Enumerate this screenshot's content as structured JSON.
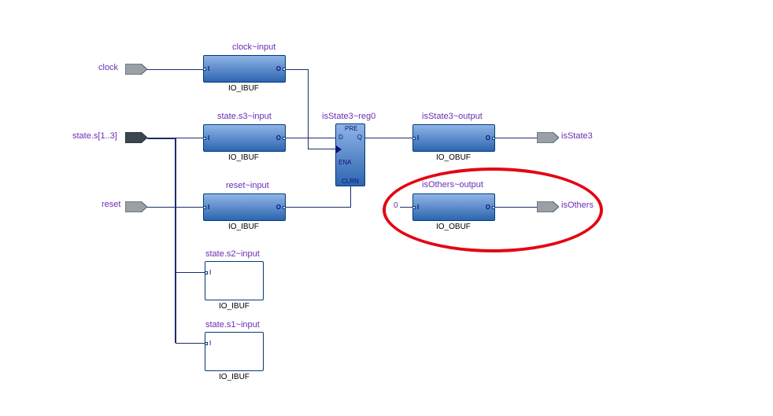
{
  "ports": {
    "clock": "clock",
    "state_bus": "state.s[1..3]",
    "reset": "reset",
    "isState3": "isState3",
    "isOthers": "isOthers"
  },
  "blocks": {
    "clock_input": {
      "title": "clock~input",
      "sub": "IO_IBUF"
    },
    "state_s3_input": {
      "title": "state.s3~input",
      "sub": "IO_IBUF"
    },
    "reset_input": {
      "title": "reset~input",
      "sub": "IO_IBUF"
    },
    "state_s2_input": {
      "title": "state.s2~input",
      "sub": "IO_IBUF"
    },
    "state_s1_input": {
      "title": "state.s1~input",
      "sub": "IO_IBUF"
    },
    "isState3_out": {
      "title": "isState3~output",
      "sub": "IO_OBUF"
    },
    "isOthers_out": {
      "title": "isOthers~output",
      "sub": "IO_OBUF"
    }
  },
  "reg": {
    "title": "isState3~reg0",
    "pre": "PRE",
    "d": "D",
    "q": "Q",
    "ena": "ENA",
    "clrn": "CLRN"
  },
  "pins": {
    "i": "I",
    "o": "O"
  },
  "consts": {
    "zero": "0"
  }
}
